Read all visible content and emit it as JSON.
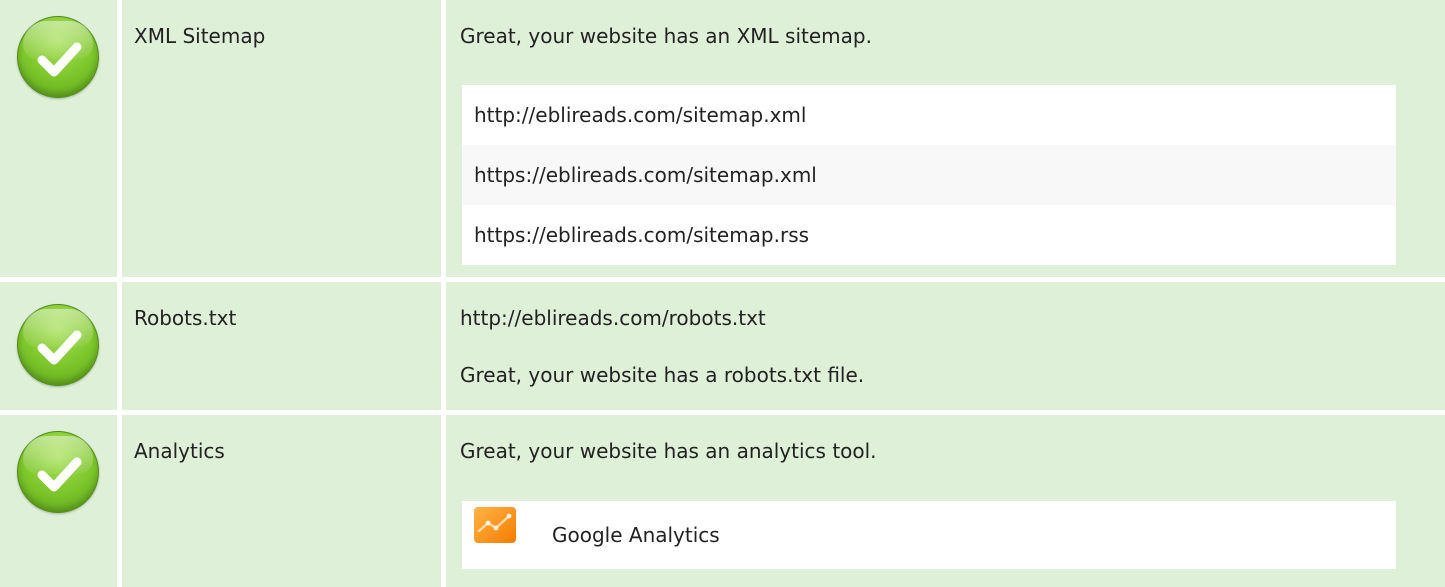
{
  "colors": {
    "row_bg": "#dff0d8",
    "list_odd": "#ffffff",
    "list_even": "#f8f8f8",
    "check_green": "#7cc52a",
    "ga_orange": "#f57c00"
  },
  "rows": [
    {
      "status_icon": "check-icon",
      "name": "XML Sitemap",
      "message": "Great, your website has an XML sitemap.",
      "sitemaps": [
        "http://eblireads.com/sitemap.xml",
        "https://eblireads.com/sitemap.xml",
        "https://eblireads.com/sitemap.rss"
      ]
    },
    {
      "status_icon": "check-icon",
      "name": "Robots.txt",
      "robots_url": "http://eblireads.com/robots.txt",
      "message": "Great, your website has a robots.txt file."
    },
    {
      "status_icon": "check-icon",
      "name": "Analytics",
      "message": "Great, your website has an analytics tool.",
      "tools": [
        {
          "icon": "google-analytics-icon",
          "label": "Google Analytics"
        }
      ]
    }
  ]
}
